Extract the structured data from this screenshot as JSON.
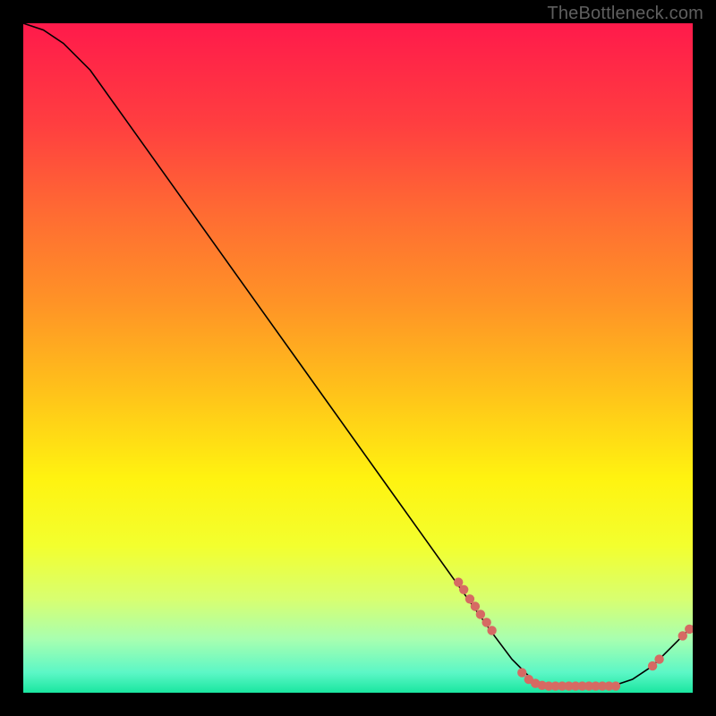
{
  "watermark": "TheBottleneck.com",
  "chart_data": {
    "type": "line",
    "title": "",
    "xlabel": "",
    "ylabel": "",
    "xlim": [
      0,
      100
    ],
    "ylim": [
      0,
      100
    ],
    "grid": false,
    "legend": false,
    "gradient_stops": [
      {
        "offset": 0.0,
        "color": "#ff1a4b"
      },
      {
        "offset": 0.15,
        "color": "#ff3e40"
      },
      {
        "offset": 0.28,
        "color": "#ff6a33"
      },
      {
        "offset": 0.42,
        "color": "#ff9426"
      },
      {
        "offset": 0.55,
        "color": "#ffc21a"
      },
      {
        "offset": 0.68,
        "color": "#fff310"
      },
      {
        "offset": 0.78,
        "color": "#f3ff2e"
      },
      {
        "offset": 0.86,
        "color": "#d8ff70"
      },
      {
        "offset": 0.92,
        "color": "#a8ffb0"
      },
      {
        "offset": 0.97,
        "color": "#5cf7c6"
      },
      {
        "offset": 1.0,
        "color": "#1ae6a0"
      }
    ],
    "curve": {
      "name": "bottleneck-curve",
      "color": "#000000",
      "points": [
        {
          "x": 0,
          "y": 100
        },
        {
          "x": 3,
          "y": 99
        },
        {
          "x": 6,
          "y": 97
        },
        {
          "x": 10,
          "y": 93
        },
        {
          "x": 15,
          "y": 86
        },
        {
          "x": 20,
          "y": 79
        },
        {
          "x": 25,
          "y": 72
        },
        {
          "x": 30,
          "y": 65
        },
        {
          "x": 35,
          "y": 58
        },
        {
          "x": 40,
          "y": 51
        },
        {
          "x": 45,
          "y": 44
        },
        {
          "x": 50,
          "y": 37
        },
        {
          "x": 55,
          "y": 30
        },
        {
          "x": 60,
          "y": 23
        },
        {
          "x": 65,
          "y": 16
        },
        {
          "x": 70,
          "y": 9
        },
        {
          "x": 73,
          "y": 5
        },
        {
          "x": 76,
          "y": 2
        },
        {
          "x": 78,
          "y": 1
        },
        {
          "x": 80,
          "y": 1
        },
        {
          "x": 84,
          "y": 1
        },
        {
          "x": 88,
          "y": 1
        },
        {
          "x": 91,
          "y": 2
        },
        {
          "x": 94,
          "y": 4
        },
        {
          "x": 97,
          "y": 7
        },
        {
          "x": 100,
          "y": 10
        }
      ]
    },
    "marker_points": {
      "name": "highlight-dots",
      "color": "#d66a63",
      "radius": 5.2,
      "points": [
        {
          "x": 65.0,
          "y": 16.5
        },
        {
          "x": 65.8,
          "y": 15.4
        },
        {
          "x": 66.7,
          "y": 14.0
        },
        {
          "x": 67.5,
          "y": 12.9
        },
        {
          "x": 68.3,
          "y": 11.7
        },
        {
          "x": 69.2,
          "y": 10.5
        },
        {
          "x": 70.0,
          "y": 9.3
        },
        {
          "x": 74.5,
          "y": 3.0
        },
        {
          "x": 75.5,
          "y": 2.0
        },
        {
          "x": 76.5,
          "y": 1.4
        },
        {
          "x": 77.5,
          "y": 1.1
        },
        {
          "x": 78.5,
          "y": 1.0
        },
        {
          "x": 79.5,
          "y": 1.0
        },
        {
          "x": 80.5,
          "y": 1.0
        },
        {
          "x": 81.5,
          "y": 1.0
        },
        {
          "x": 82.5,
          "y": 1.0
        },
        {
          "x": 83.5,
          "y": 1.0
        },
        {
          "x": 84.5,
          "y": 1.0
        },
        {
          "x": 85.5,
          "y": 1.0
        },
        {
          "x": 86.5,
          "y": 1.0
        },
        {
          "x": 87.5,
          "y": 1.0
        },
        {
          "x": 88.5,
          "y": 1.0
        },
        {
          "x": 94.0,
          "y": 4.0
        },
        {
          "x": 95.0,
          "y": 5.0
        },
        {
          "x": 98.5,
          "y": 8.5
        },
        {
          "x": 99.5,
          "y": 9.5
        }
      ]
    }
  }
}
